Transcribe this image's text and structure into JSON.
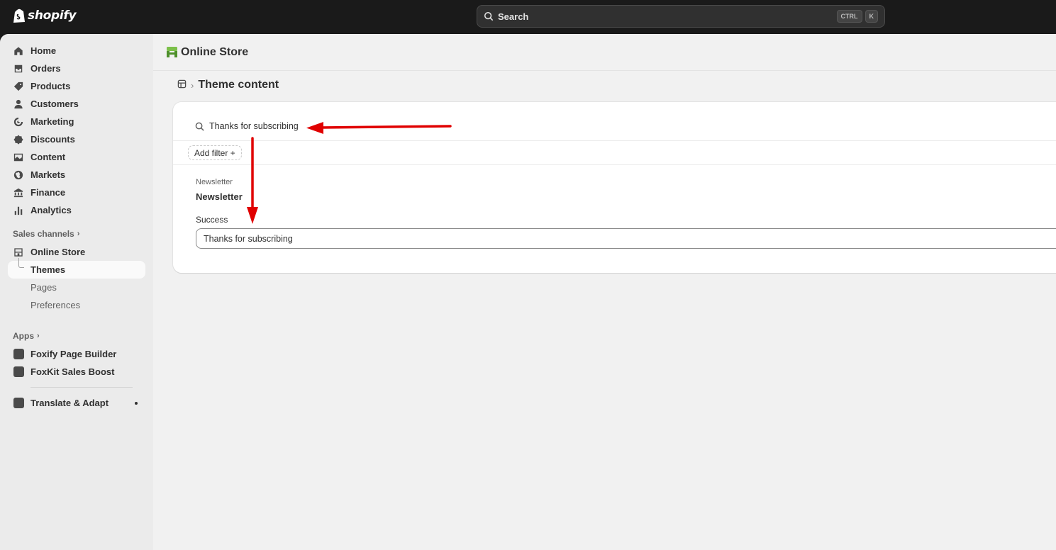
{
  "topbar": {
    "logo_text": "shopify",
    "search_label": "Search",
    "shortcut_keys": [
      "CTRL",
      "K"
    ]
  },
  "sidebar": {
    "items": [
      {
        "label": "Home",
        "icon": "home-icon"
      },
      {
        "label": "Orders",
        "icon": "inbox-icon"
      },
      {
        "label": "Products",
        "icon": "tag-icon"
      },
      {
        "label": "Customers",
        "icon": "person-icon"
      },
      {
        "label": "Marketing",
        "icon": "target-icon"
      },
      {
        "label": "Discounts",
        "icon": "discount-icon"
      },
      {
        "label": "Content",
        "icon": "image-icon"
      },
      {
        "label": "Markets",
        "icon": "globe-icon"
      },
      {
        "label": "Finance",
        "icon": "bank-icon"
      },
      {
        "label": "Analytics",
        "icon": "bar-chart-icon"
      }
    ],
    "sales_channels_label": "Sales channels",
    "online_store_label": "Online Store",
    "online_store_subitems": [
      "Themes",
      "Pages",
      "Preferences"
    ],
    "apps_label": "Apps",
    "apps": [
      "Foxify Page Builder",
      "FoxKit Sales Boost"
    ],
    "translate_label": "Translate & Adapt"
  },
  "page": {
    "title": "Online Store",
    "breadcrumb_title": "Theme content",
    "search_value": "Thanks for subscribing",
    "add_filter_label": "Add filter +",
    "group_label": "Newsletter",
    "group_title": "Newsletter",
    "field_label": "Success",
    "field_value": "Thanks for subscribing"
  },
  "colors": {
    "topbar": "#1a1a1a",
    "sidebar": "#ebebeb",
    "main_bg": "#f1f1f1",
    "annotation_arrow": "#e00000"
  }
}
